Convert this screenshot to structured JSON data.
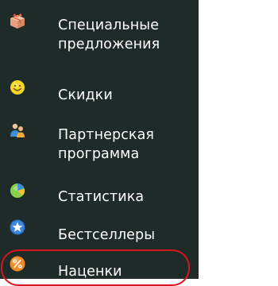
{
  "menu": {
    "items": [
      {
        "label": "Специальные\nпредложения",
        "icon": "gift-box-icon"
      },
      {
        "label": "Скидки",
        "icon": "smiley-icon"
      },
      {
        "label": "Партнерская\nпрограмма",
        "icon": "partner-users-icon"
      },
      {
        "label": "Статистика",
        "icon": "pie-chart-icon"
      },
      {
        "label": "Бестселлеры",
        "icon": "star-badge-icon"
      },
      {
        "label": "Наценки",
        "icon": "percent-icon"
      }
    ],
    "highlighted_item": "Наценки",
    "highlight_color": "#d7161d",
    "panel_background": "#1e2b28",
    "text_color": "#ffffff"
  }
}
